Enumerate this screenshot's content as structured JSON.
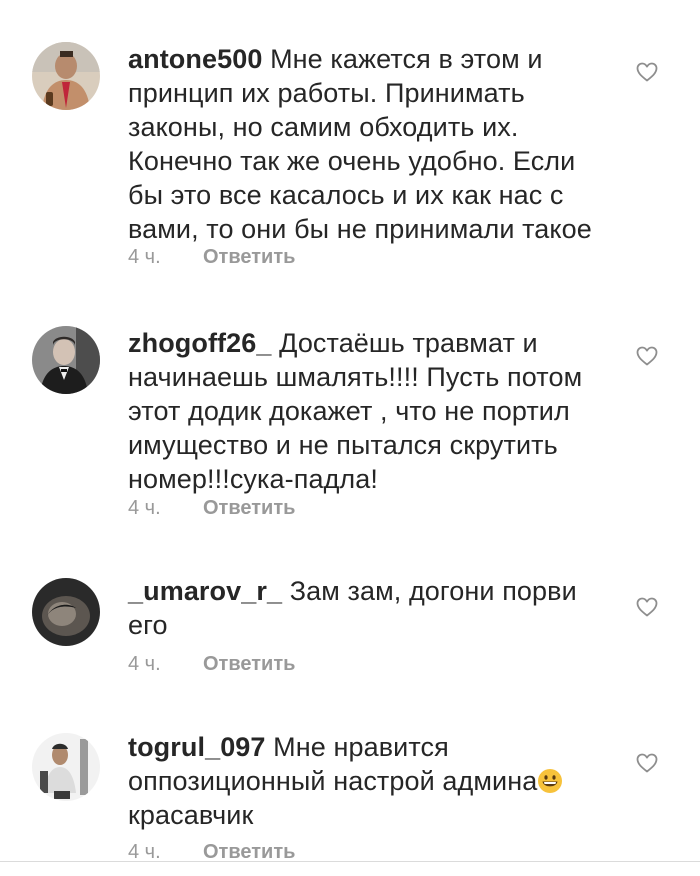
{
  "comments": [
    {
      "username": "antone500",
      "text": "Мне кажется в этом и принцип их работы.  Принимать законы, но самим обходить их. Конечно так же очень удобно. Если бы это все касалось и их как нас с вами, то они бы не принимали такое",
      "time": "4 ч.",
      "reply_label": "Ответить",
      "avatar_icon": "avatar-photo"
    },
    {
      "username": "zhogoff26_",
      "text": "Достаёшь травмат и начинаешь шмалять!!!! Пусть потом этот додик докажет , что не портил имущество и не пытался скрутить номер!!!сука-падла!",
      "time": "4 ч.",
      "reply_label": "Ответить",
      "avatar_icon": "avatar-photo"
    },
    {
      "username": "_umarov_r_",
      "text": "Зам зам, догони порви его",
      "time": "4 ч.",
      "reply_label": "Ответить",
      "avatar_icon": "avatar-photo"
    },
    {
      "username": "togrul_097",
      "text": "Мне нравится оппозиционный настрой админа",
      "text_emoji": "grinning-face-emoji",
      "text_after": "красавчик",
      "time": "4 ч.",
      "reply_label": "Ответить",
      "avatar_icon": "avatar-photo"
    }
  ],
  "icons": {
    "like": "heart-outline-icon"
  },
  "colors": {
    "text": "#262626",
    "meta": "#999999",
    "heart": "#8e8e8e"
  }
}
